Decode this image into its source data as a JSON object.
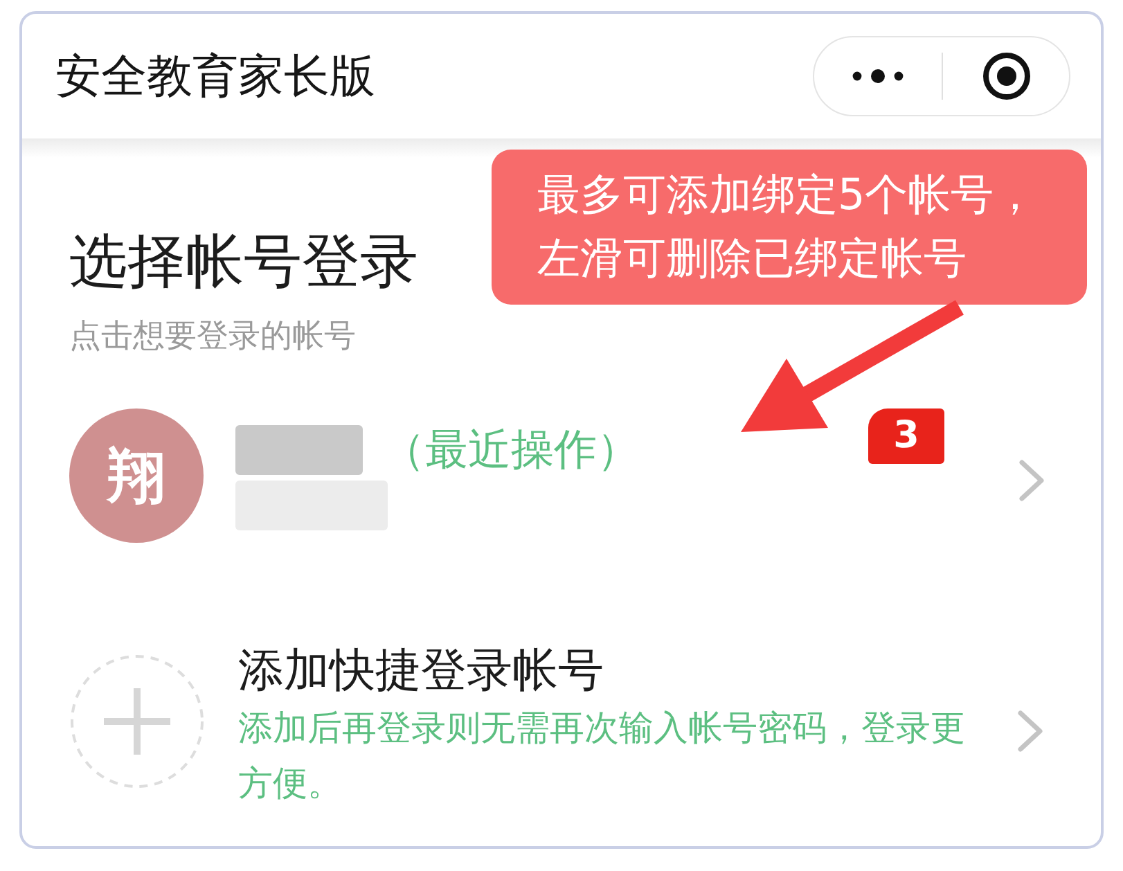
{
  "header": {
    "title": "安全教育家长版"
  },
  "callout": {
    "lines": [
      "最多可添加绑定5个帐号，",
      "左滑可删除已绑定帐号"
    ]
  },
  "login": {
    "heading": "选择帐号登录",
    "hint": "点击想要登录的帐号"
  },
  "accounts": [
    {
      "avatar_text": "翔",
      "tag": "（最近操作）",
      "badge": "3"
    }
  ],
  "add_account": {
    "title": "添加快捷登录帐号",
    "description": "添加后再登录则无需再次输入帐号密码，登录更方便。"
  }
}
